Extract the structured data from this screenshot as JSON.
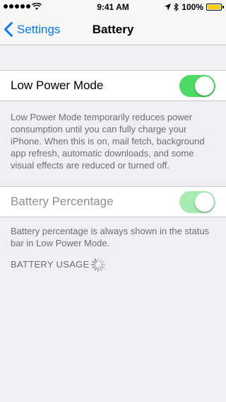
{
  "status_bar": {
    "time": "9:41 AM",
    "battery_percent": "100%",
    "battery_level": 1.0,
    "icons": [
      "signal-dots-icon",
      "wifi-icon",
      "location-arrow-icon",
      "bluetooth-icon",
      "battery-icon"
    ]
  },
  "nav": {
    "back_label": "Settings",
    "title": "Battery"
  },
  "low_power": {
    "label": "Low Power Mode",
    "on": true,
    "description": "Low Power Mode temporarily reduces power consumption until you can fully charge your iPhone. When this is on, mail fetch, background app refresh, automatic downloads, and some visual effects are reduced or turned off."
  },
  "battery_percentage": {
    "label": "Battery Percentage",
    "on": true,
    "enabled": false,
    "description": "Battery percentage is always shown in the status bar in Low Power Mode."
  },
  "usage": {
    "header": "BATTERY USAGE"
  },
  "colors": {
    "accent": "#007aff",
    "toggle_on": "#4cd964",
    "toggle_disabled": "#a6ecb2",
    "battery_fill": "#ffcc00",
    "background": "#efeff4"
  }
}
